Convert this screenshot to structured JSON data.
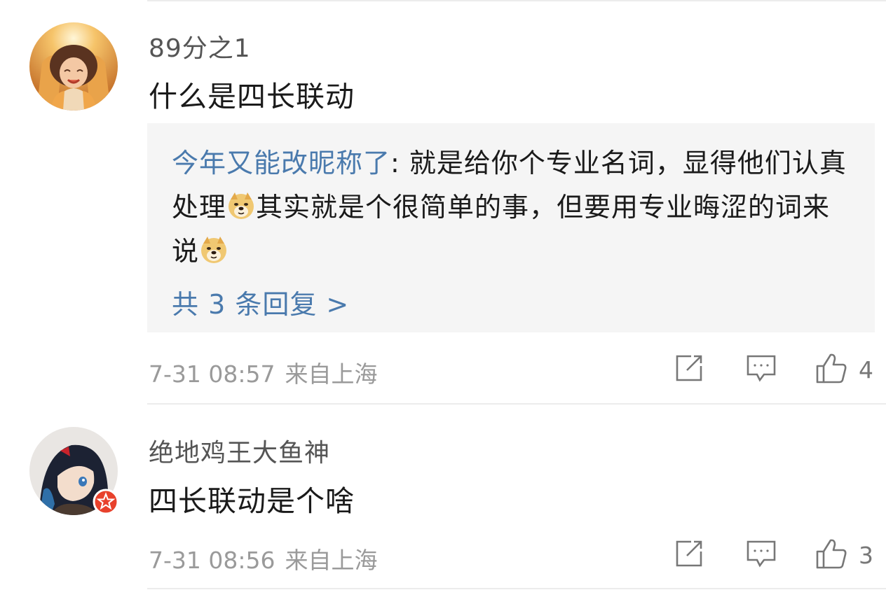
{
  "comments": [
    {
      "username": "89分之1",
      "content": "什么是四长联动",
      "reply_preview": {
        "author": "今年又能改昵称了",
        "separator": ": ",
        "text_1": "就是给你个专业名词，显得他们认真处理",
        "text_2": "其实就是个很简单的事，但要用专业晦涩的词来说",
        "emoji": "doge-emoji"
      },
      "more_replies": "共 3 条回复 >",
      "time": "7-31 08:57",
      "location": "来自上海",
      "likes": "4"
    },
    {
      "username": "绝地鸡王大鱼神",
      "content": "四长联动是个啥",
      "time": "7-31 08:56",
      "location": "来自上海",
      "likes": "3",
      "badge": "verified-star-badge"
    }
  ],
  "icons": {
    "share": "share-icon",
    "reply": "comment-icon",
    "like": "thumbs-up-icon"
  },
  "colors": {
    "link": "#4a7aad",
    "meta": "#9a9a9a",
    "username": "#555555",
    "badge": "#e8412c",
    "reply_bg": "#f5f5f5"
  }
}
